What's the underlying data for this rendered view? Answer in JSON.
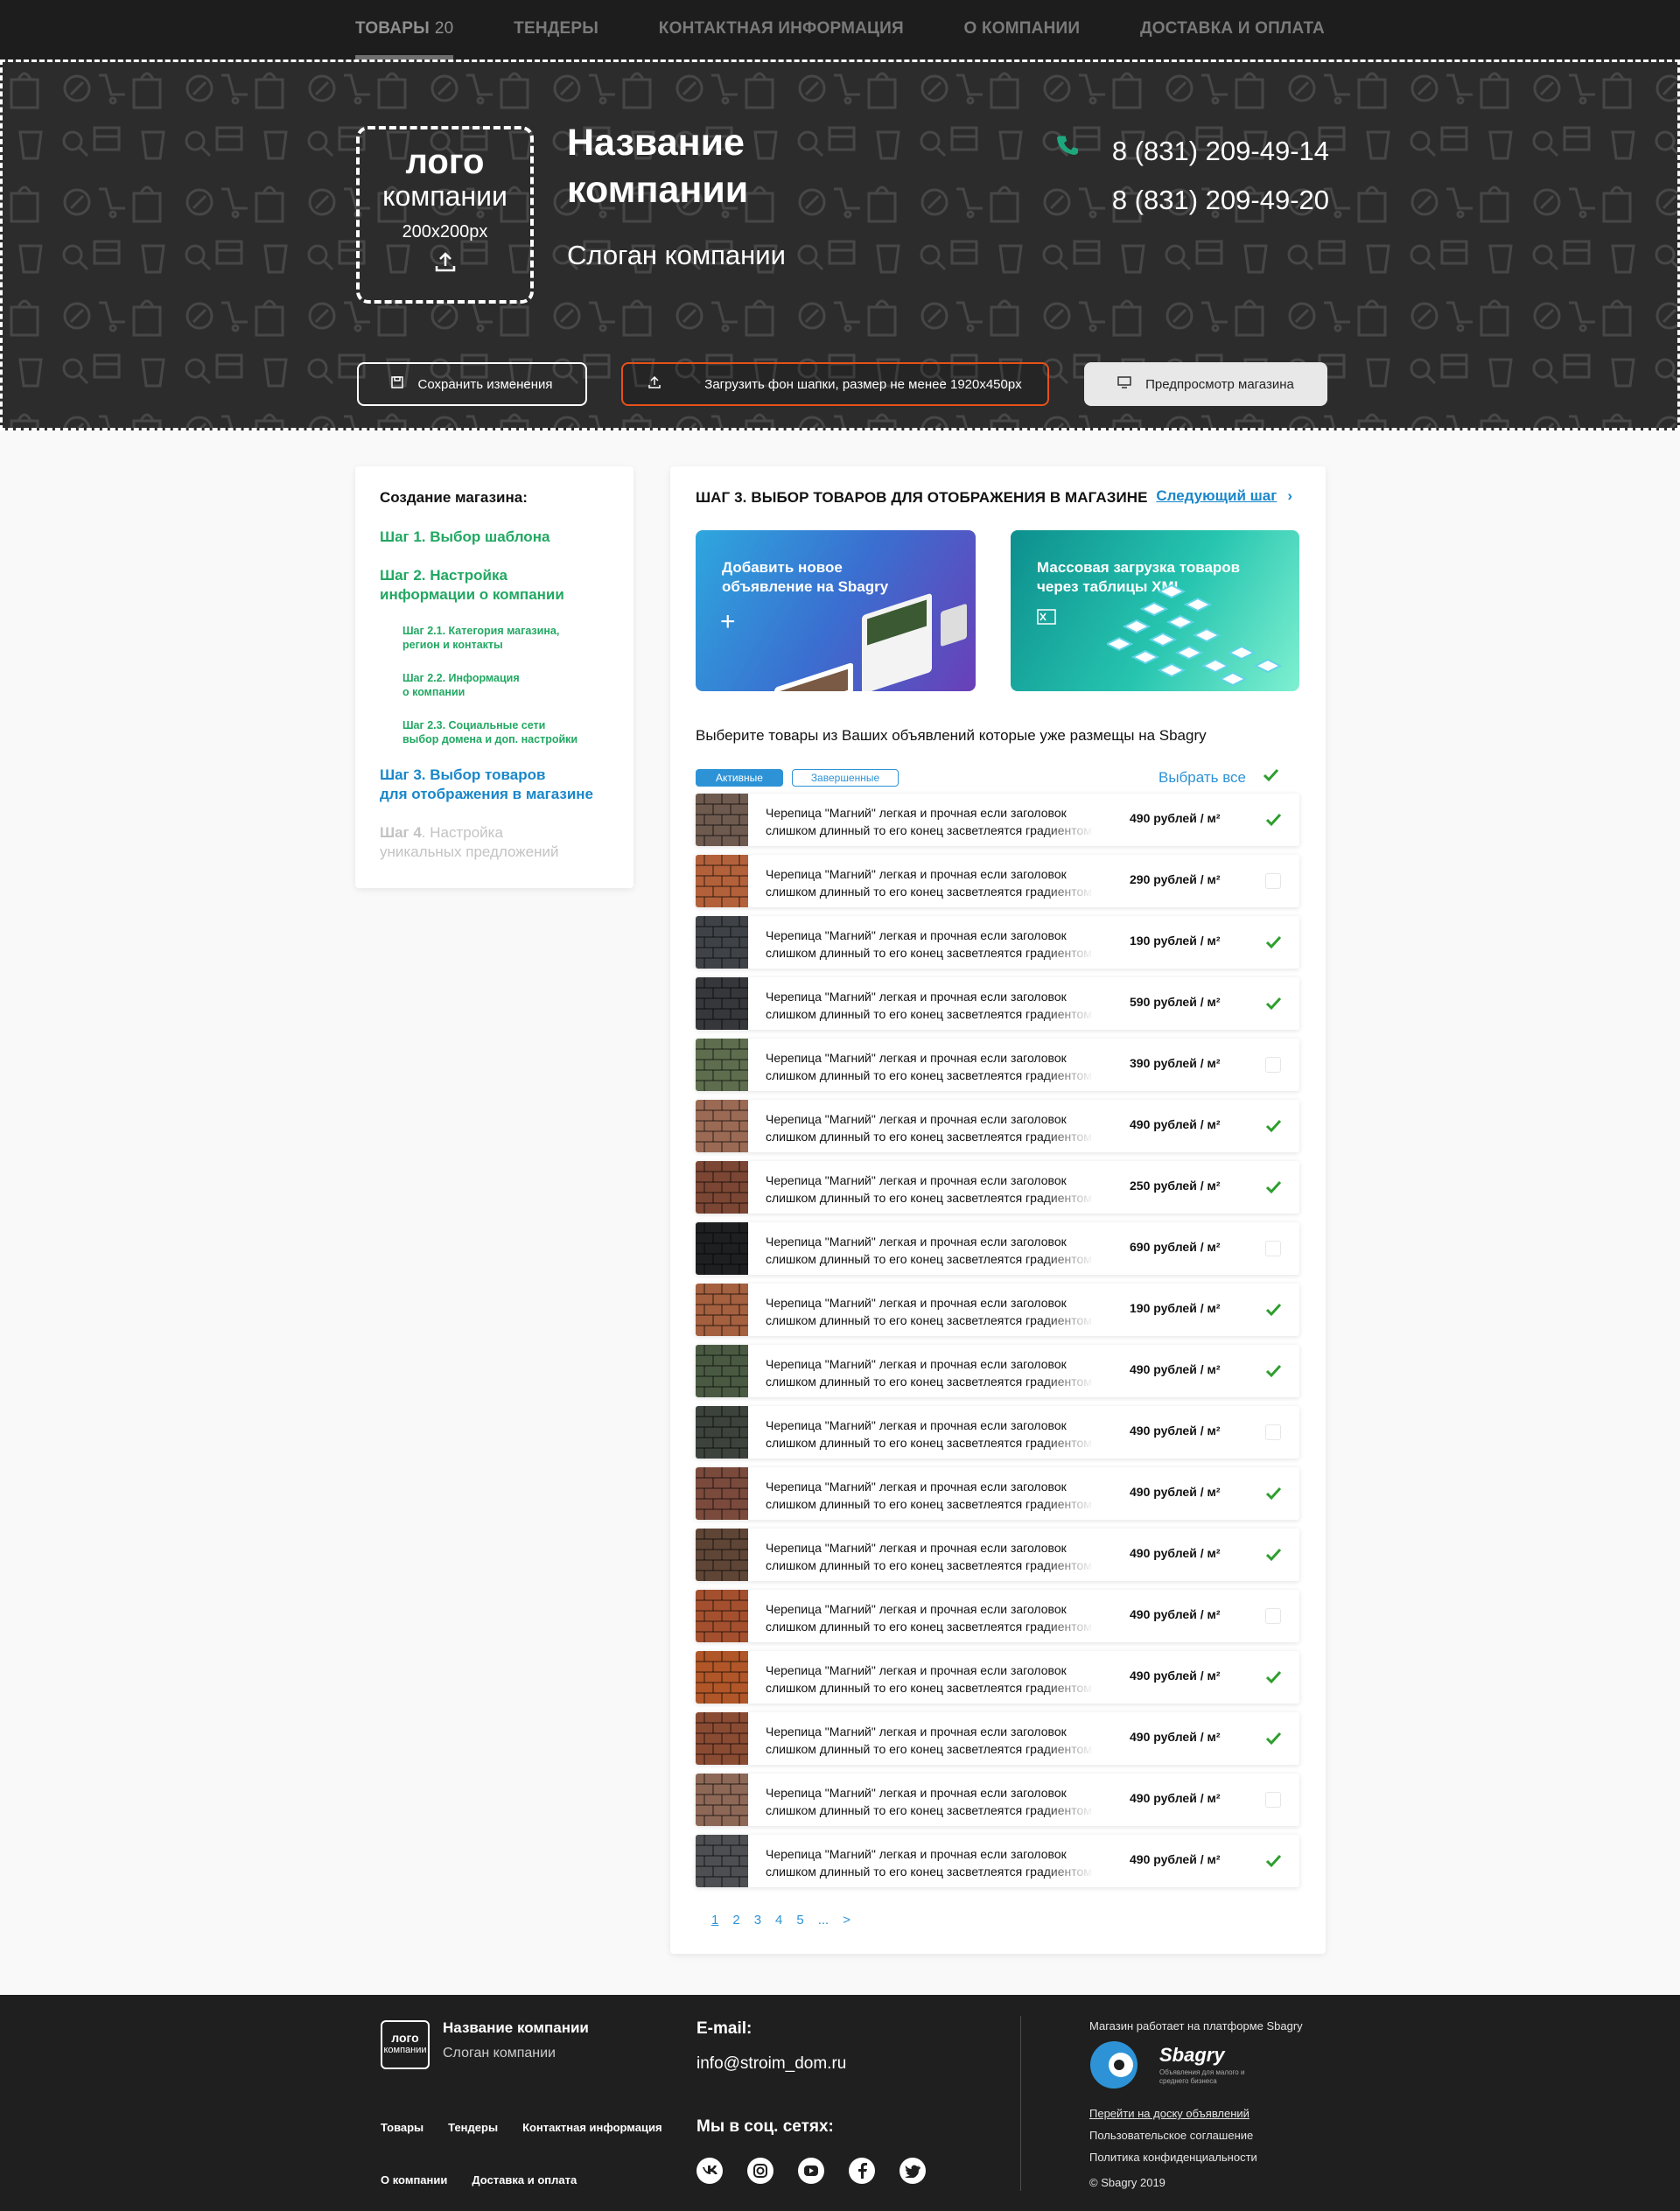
{
  "nav": {
    "items": [
      {
        "label": "ТОВАРЫ",
        "count": "20"
      },
      {
        "label": "ТЕНДЕРЫ"
      },
      {
        "label": "КОНТАКТНАЯ ИНФОРМАЦИЯ"
      },
      {
        "label": "О КОМПАНИИ"
      },
      {
        "label": "ДОСТАВКА И ОПЛАТА"
      }
    ]
  },
  "header": {
    "logo_line1": "лого",
    "logo_line2": "компании",
    "logo_size": "200x200px",
    "company_name": "Название компании",
    "slogan": "Слоган компании",
    "phone1": "8 (831) 209-49-14",
    "phone2": "8 (831) 209-49-20",
    "save_label": "Сохранить изменения",
    "upload_label": "Загрузить фон шапки, размер не менее 1920x450px",
    "preview_label": "Предпросмотр магазина",
    "accent_color": "#e5521a"
  },
  "sidebar": {
    "title": "Создание магазина:",
    "step1": "Шаг 1. Выбор шаблона",
    "step2_l1": "Шаг 2. Настройка",
    "step2_l2": "информации о компании",
    "step21_l1": "Шаг 2.1. Категория магазина,",
    "step21_l2": "регион и контакты",
    "step22_l1": "Шаг 2.2. Информация",
    "step22_l2": "о компании",
    "step23_l1": "Шаг 2.3. Социальные сети",
    "step23_l2": "выбор домена и доп. настройки",
    "step3_l1": "Шаг 3. Выбор товаров",
    "step3_l2": "для отображения в магазине",
    "step4_bold": "Шаг 4",
    "step4_l1": ". Настройка",
    "step4_l2": "уникальных предложений",
    "done_color": "#21a862",
    "current_color": "#1a87c9"
  },
  "main": {
    "title": "ШАГ 3. ВЫБОР ТОВАРОВ ДЛЯ ОТОБРАЖЕНИЯ В МАГАЗИНЕ",
    "next_step": "Следующий шаг",
    "card1_l1": "Добавить новое",
    "card1_l2": "объявление на Sbagry",
    "card2_l1": "Массовая загрузка товаров",
    "card2_l2": "через таблицы XML",
    "intro": "Выберите товары из Ваших объявлений которые уже размещы на Sbagry",
    "tab_active": "Активные",
    "tab_done": "Завершенные",
    "select_all": "Выбрать все",
    "product_line1": "Черепица \"Магний\" легкая и прочная если заголовок",
    "product_line2": "слишком длинный то его конец засветлеятся градиентом",
    "products": [
      {
        "price": "490 рублей / м²",
        "checked": true,
        "color": "#6e5a4f"
      },
      {
        "price": "290 рублей / м²",
        "checked": false,
        "color": "#b3613a"
      },
      {
        "price": "190 рублей / м²",
        "checked": true,
        "color": "#3f4247"
      },
      {
        "price": "590 рублей / м²",
        "checked": true,
        "color": "#35373b"
      },
      {
        "price": "390 рублей / м²",
        "checked": false,
        "color": "#5d6d4e"
      },
      {
        "price": "490 рублей / м²",
        "checked": true,
        "color": "#9a6a55"
      },
      {
        "price": "250 рублей / м²",
        "checked": true,
        "color": "#7b4634"
      },
      {
        "price": "690 рублей / м²",
        "checked": false,
        "color": "#1e1f21"
      },
      {
        "price": "190 рублей / м²",
        "checked": true,
        "color": "#a4603f"
      },
      {
        "price": "490 рублей / м²",
        "checked": true,
        "color": "#4a5a42"
      },
      {
        "price": "490 рублей / м²",
        "checked": false,
        "color": "#3c423c"
      },
      {
        "price": "490 рублей / м²",
        "checked": true,
        "color": "#7a4a3d"
      },
      {
        "price": "490 рублей / м²",
        "checked": true,
        "color": "#5e4536"
      },
      {
        "price": "490 рублей / м²",
        "checked": false,
        "color": "#a4502f"
      },
      {
        "price": "490 рублей / м²",
        "checked": true,
        "color": "#b05628"
      },
      {
        "price": "490 рублей / м²",
        "checked": true,
        "color": "#8a4b33"
      },
      {
        "price": "490 рублей / м²",
        "checked": false,
        "color": "#8d6857"
      },
      {
        "price": "490 рублей / м²",
        "checked": true,
        "color": "#4d4f52"
      }
    ],
    "pages": [
      "1",
      "2",
      "3",
      "4",
      "5",
      "...",
      ">"
    ],
    "check_color": "#2e9e2e"
  },
  "footer": {
    "logo_l1": "лого",
    "logo_l2": "компании",
    "company_name": "Название компании",
    "slogan": "Слоган компании",
    "links_row1": [
      "Товары",
      "Тендеры",
      "Контактная информация"
    ],
    "links_row2": [
      "О компании",
      "Доставка и оплата"
    ],
    "email_heading": "E-mail:",
    "email": "info@stroim_dom.ru",
    "social_heading": "Мы в соц. сетях:",
    "social_icons": [
      "vk-icon",
      "instagram-icon",
      "youtube-icon",
      "facebook-icon",
      "twitter-icon"
    ],
    "platform_text": "Магазин работает на платформе Sbagry",
    "brand": "Sbagry",
    "brand_sub": "Объявления для малого и среднего бизнеса",
    "link_board": "Перейти на доску объявлений",
    "link_terms": "Пользовательское соглашение",
    "link_privacy": "Политика конфиденциальности",
    "copyright": "© Sbagry 2019"
  }
}
